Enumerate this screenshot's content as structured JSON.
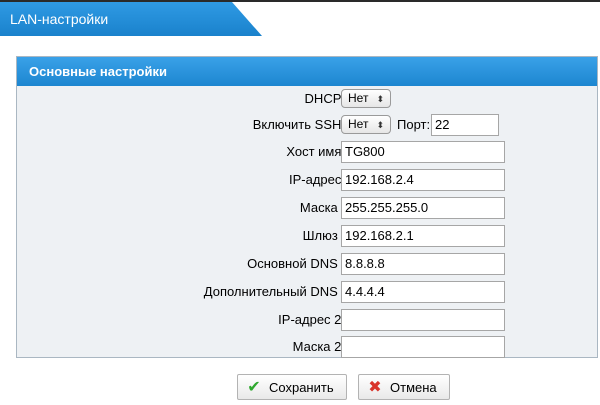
{
  "header": {
    "title": "LAN-настройки"
  },
  "panel": {
    "title": "Основные настройки"
  },
  "form": {
    "dhcp": {
      "label": "DHCP:",
      "value": "Нет"
    },
    "ssh": {
      "label": "Включить SSH:",
      "value": "Нет",
      "port_label": "Порт:",
      "port_value": "22"
    },
    "hostname": {
      "label": "Хост имя:",
      "value": "TG800"
    },
    "ip": {
      "label": "IP-адрес:",
      "value": "192.168.2.4"
    },
    "mask": {
      "label": "Маска :",
      "value": "255.255.255.0"
    },
    "gateway": {
      "label": "Шлюз :",
      "value": "192.168.2.1"
    },
    "dns1": {
      "label": "Основной DNS :",
      "value": "8.8.8.8"
    },
    "dns2": {
      "label": "Дополнительный DNS :",
      "value": "4.4.4.4"
    },
    "ip2": {
      "label": "IP-адрес 2:",
      "value": ""
    },
    "mask2": {
      "label": "Маска 2:",
      "value": ""
    }
  },
  "buttons": {
    "save": "Сохранить",
    "cancel": "Отмена"
  },
  "icons": {
    "save": "checkmark-icon",
    "cancel": "cross-icon",
    "select_arrow": "updown-arrows-icon"
  },
  "colors": {
    "header_blue": "#1a82cc",
    "check_green": "#2fa82f",
    "cancel_red": "#d9342b"
  }
}
